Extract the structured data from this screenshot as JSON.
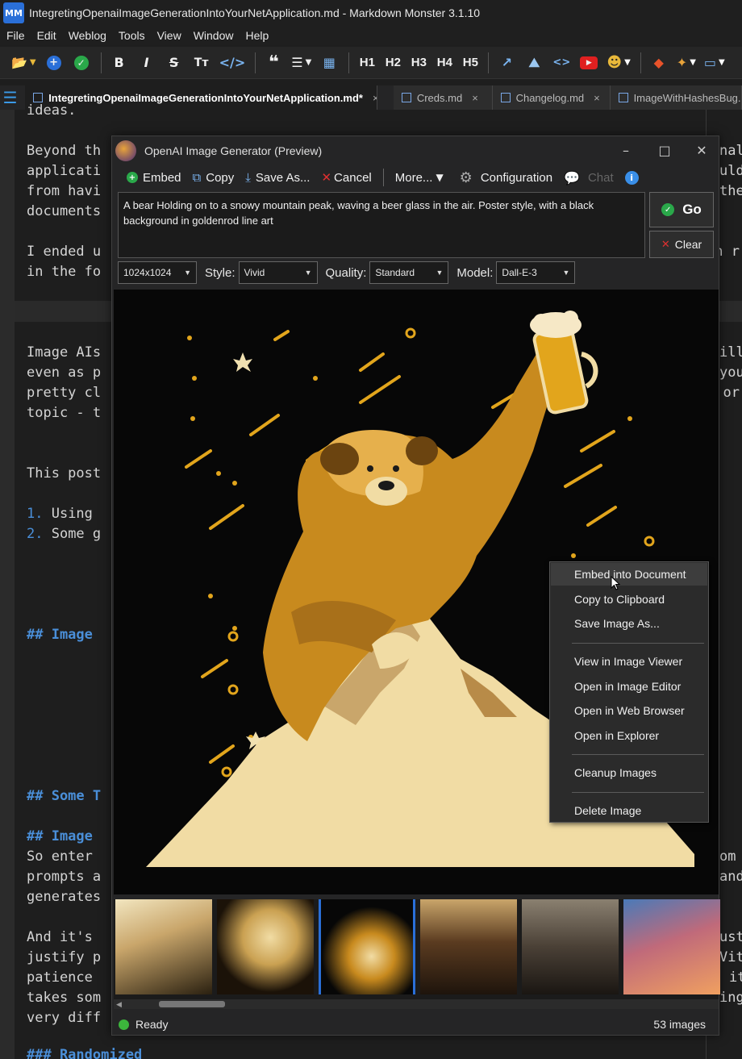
{
  "window": {
    "title": "IntegretingOpenaiImageGenerationIntoYourNetApplication.md - Markdown Monster 3.1.10",
    "logo_text": "MM"
  },
  "menu": [
    "File",
    "Edit",
    "Weblog",
    "Tools",
    "View",
    "Window",
    "Help"
  ],
  "toolbar": {
    "headings": [
      "H1",
      "H2",
      "H3",
      "H4",
      "H5"
    ]
  },
  "tabs": [
    {
      "label": "IntegretingOpenaiImageGenerationIntoYourNetApplication.md*",
      "close": "×"
    },
    {
      "label": "Creds.md",
      "close": "×"
    },
    {
      "label": "Changelog.md",
      "close": "×"
    },
    {
      "label": "ImageWithHashesBug.r",
      "close": ""
    }
  ],
  "editor": {
    "lines": [
      "ideas.",
      "Beyond th",
      "applicati",
      "from havi",
      "documents",
      "I ended u",
      "in the fo",
      "Image AIs",
      "even as p",
      "pretty cl",
      "topic - t",
      "This post",
      "Using",
      "Some g",
      "## Image",
      "## Some T",
      "## Image",
      "So enter",
      "prompts a",
      "generates",
      "And it's",
      "justify p",
      "patience",
      "takes som",
      "very diff",
      "### Randomized"
    ],
    "right_fragments": [
      "nal",
      "uld",
      "ther",
      "ch r",
      "ille",
      "you",
      "g or",
      "om t",
      "and",
      "ust",
      "Vith",
      "it",
      "ing"
    ]
  },
  "dialog": {
    "title": "OpenAI Image Generator (Preview)",
    "buttons": {
      "embed": "Embed",
      "copy": "Copy",
      "save_as": "Save As...",
      "cancel": "Cancel",
      "more": "More...",
      "configuration": "Configuration",
      "chat": "Chat"
    },
    "prompt": "A bear Holding on to a snowy mountain peak, waving a beer glass in the air. Poster style, with a black background in goldenrod line art",
    "go_label": "Go",
    "clear_label": "Clear",
    "size_value": "1024x1024",
    "style_label": "Style:",
    "style_value": "Vivid",
    "quality_label": "Quality:",
    "quality_value": "Standard",
    "model_label": "Model:",
    "model_value": "Dall-E-3",
    "status": "Ready",
    "image_count": "53 images"
  },
  "context_menu": {
    "items": [
      "Embed into Document",
      "Copy to Clipboard",
      "Save Image As...",
      "View in Image Viewer",
      "Open in Image Editor",
      "Open in Web Browser",
      "Open in Explorer",
      "Cleanup Images",
      "Delete Image"
    ]
  },
  "colors": {
    "accent_blue": "#2a6fd8",
    "goldenrod": "#e2a51c",
    "status_green": "#3cb53c",
    "heading_blue": "#4a8fd9"
  }
}
